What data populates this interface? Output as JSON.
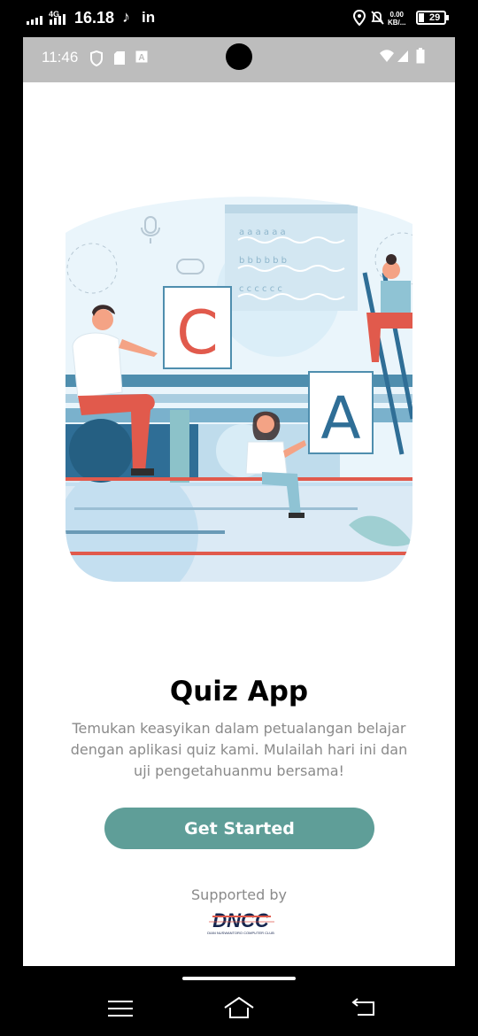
{
  "outer_status": {
    "network": "4G",
    "time": "16.18",
    "app_icon_1": "tiktok-icon",
    "app_icon_2": "linkedin-icon",
    "linkedin_text": "in",
    "speed_value": "0.00",
    "speed_unit": "KB/...",
    "battery": "29"
  },
  "emulator_status": {
    "time": "11:46"
  },
  "app": {
    "illustration_letters": [
      "C",
      "A"
    ],
    "title": "Quiz App",
    "description": "Temukan keasyikan dalam petualangan belajar dengan aplikasi quiz kami. Mulailah hari ini dan uji pengetahuanmu bersama!",
    "button_label": "Get Started",
    "supported_label": "Supported by",
    "logo_text": "DNCC",
    "logo_subtext": "DIAN NUSWANTORO COMPUTER CLUB"
  },
  "colors": {
    "button": "#5f9e98",
    "accent_red": "#e15a4c",
    "accent_blue": "#2f6e96"
  }
}
